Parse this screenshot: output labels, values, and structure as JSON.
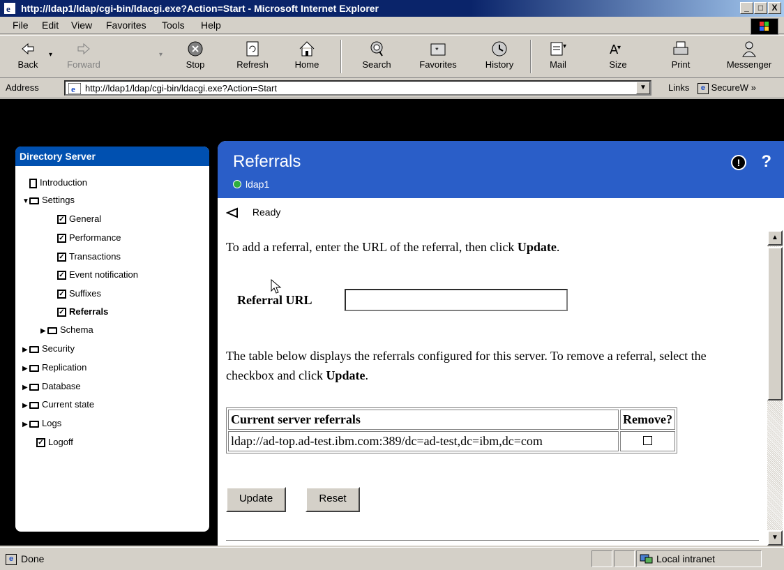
{
  "window": {
    "title": "http://ldap1/ldap/cgi-bin/ldacgi.exe?Action=Start - Microsoft Internet Explorer",
    "controls": [
      "_",
      "□",
      "X"
    ]
  },
  "menu": [
    "File",
    "Edit",
    "View",
    "Favorites",
    "Tools",
    "Help"
  ],
  "toolbar": {
    "back": "Back",
    "forward": "Forward",
    "stop": "Stop",
    "refresh": "Refresh",
    "home": "Home",
    "search": "Search",
    "favorites": "Favorites",
    "history": "History",
    "mail": "Mail",
    "size": "Size",
    "print": "Print",
    "messenger": "Messenger"
  },
  "address": {
    "label": "Address",
    "url": "http://ldap1/ldap/cgi-bin/ldacgi.exe?Action=Start",
    "links": "Links",
    "link_item": "SecureW",
    "more": "»"
  },
  "sidebar": {
    "title": "Directory Server",
    "items": {
      "introduction": "Introduction",
      "settings": "Settings",
      "general": "General",
      "performance": "Performance",
      "transactions": "Transactions",
      "event_notification": "Event notification",
      "suffixes": "Suffixes",
      "referrals": "Referrals",
      "schema": "Schema",
      "security": "Security",
      "replication": "Replication",
      "database": "Database",
      "current_state": "Current state",
      "logs": "Logs",
      "logoff": "Logoff"
    }
  },
  "main": {
    "title": "Referrals",
    "server": "ldap1",
    "status": "Ready",
    "instruction_add_prefix": "To add a referral, enter the URL of the referral, then click ",
    "instruction_add_bold": "Update",
    "instruction_add_suffix": ".",
    "referral_url_label": "Referral URL",
    "referral_url_value": "",
    "instruction_remove_prefix": "The table below displays the referrals configured for this server. To remove a referral, select the checkbox and click ",
    "instruction_remove_bold": "Update",
    "instruction_remove_suffix": ".",
    "table": {
      "headers": [
        "Current server referrals",
        "Remove?"
      ],
      "rows": [
        {
          "referral": "ldap://ad-top.ad-test.ibm.com:389/dc=ad-test,dc=ibm,dc=com",
          "remove": false
        }
      ]
    },
    "update_button": "Update",
    "reset_button": "Reset"
  },
  "statusbar": {
    "text": "Done",
    "zone": "Local intranet"
  }
}
